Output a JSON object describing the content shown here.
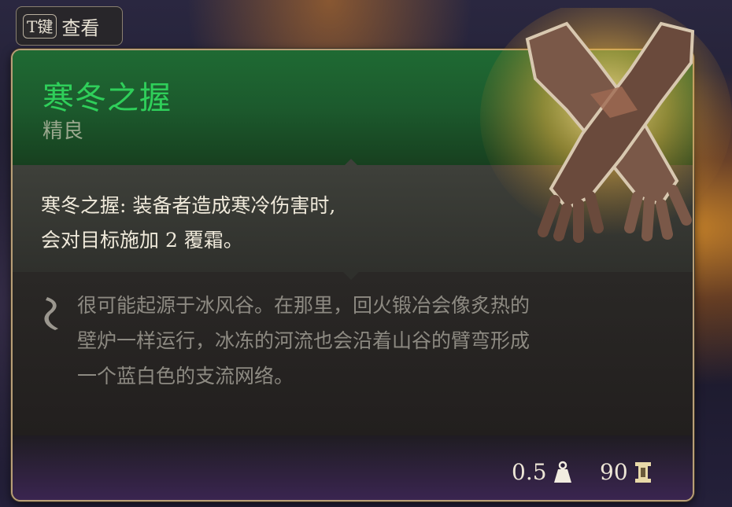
{
  "hint": {
    "key": "T键",
    "label": "查看"
  },
  "item": {
    "name": "寒冬之握",
    "rarity": "精良",
    "effect_line1": "寒冬之握: 装备者造成寒冷伤害时,",
    "effect_line2": "会对目标施加 2 覆霜。",
    "lore_line1": "很可能起源于冰风谷。在那里，回火锻冶会像炙热的",
    "lore_line2": "壁炉一样运行，冰冻的河流也会沿着山谷的臂弯形成",
    "lore_line3": "一个蓝白色的支流网络。",
    "weight": "0.5",
    "value": "90"
  },
  "icons": {
    "weight": "weight-icon",
    "gold": "gold-icon",
    "lore": "quill-icon",
    "item": "gloves-icon"
  },
  "colors": {
    "title": "#2fcf5a",
    "header_bg": "#1f6a33",
    "border": "#b89f78"
  }
}
